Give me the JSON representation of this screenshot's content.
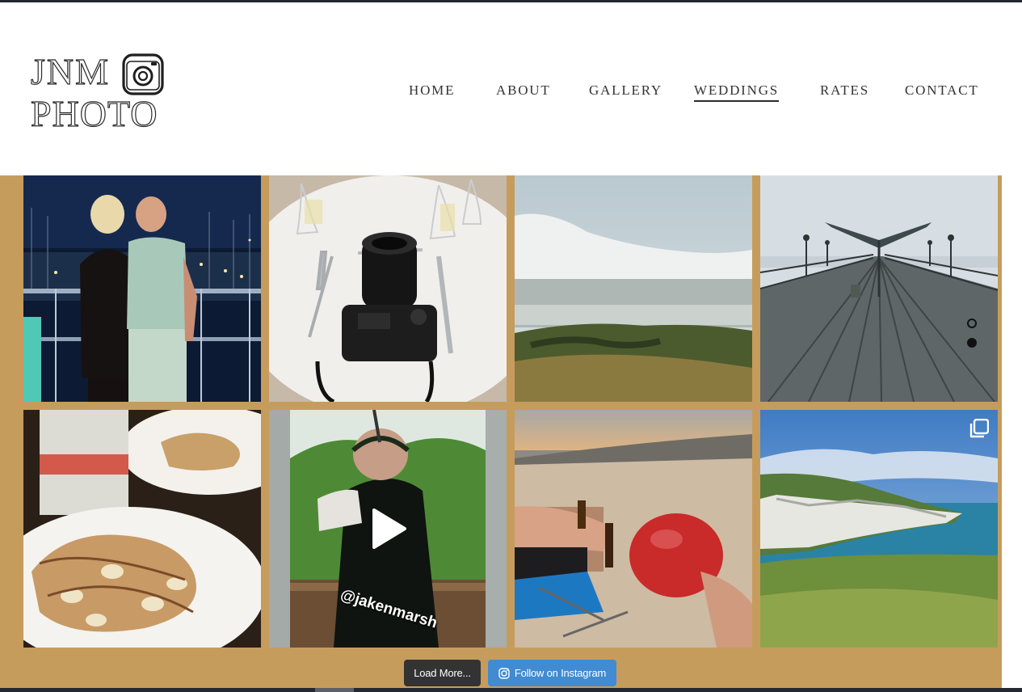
{
  "brand": {
    "logo_line1": "JNM",
    "logo_line2": "PHOTO"
  },
  "nav": {
    "items": [
      {
        "label": "HOME"
      },
      {
        "label": "ABOUT"
      },
      {
        "label": "GALLERY"
      },
      {
        "label": "WEDDINGS",
        "active": true
      },
      {
        "label": "RATES"
      },
      {
        "label": "CONTACT"
      }
    ]
  },
  "instagram_feed": {
    "posts": [
      {
        "subject": "couple-at-night-marina"
      },
      {
        "subject": "camera-on-dinner-table"
      },
      {
        "subject": "sea-fog-over-cliffs"
      },
      {
        "subject": "pier-boardwalk"
      },
      {
        "subject": "pancakes-and-milkshake"
      },
      {
        "subject": "clay-shooting-video",
        "media": "video",
        "caption": "@jakenmarsh"
      },
      {
        "subject": "beach-bbq-sunset"
      },
      {
        "subject": "needles-cliffs-coast",
        "media": "carousel"
      }
    ],
    "load_more_label": "Load More...",
    "follow_label": "Follow on Instagram"
  },
  "colors": {
    "feed_background": "#c69c5d",
    "follow_button": "#408bd1",
    "load_more_button": "#333333",
    "top_bar": "#232831"
  }
}
